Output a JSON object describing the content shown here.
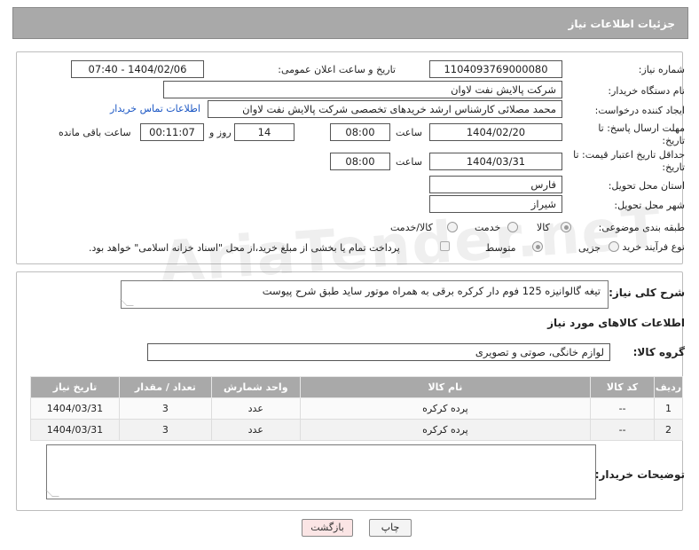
{
  "header": {
    "title": "جزئیات اطلاعات نیاز"
  },
  "fields": {
    "need_number_label": "شماره نیاز:",
    "need_number": "1104093769000080",
    "announce_label": "تاریخ و ساعت اعلان عمومی:",
    "announce_value": "1404/02/06 - 07:40",
    "buyer_org_label": "نام دستگاه خریدار:",
    "buyer_org": "شرکت پالایش نفت لاوان",
    "creator_label": "ایجاد کننده درخواست:",
    "creator": "محمد مصلائی کارشناس ارشد خریدهای تخصصی شرکت پالایش نفت لاوان",
    "contact_link": "اطلاعات تماس خریدار",
    "reply_deadline_label": "مهلت ارسال پاسخ: تا تاریخ:",
    "reply_date": "1404/02/20",
    "time_label": "ساعت",
    "reply_time": "08:00",
    "days_value": "14",
    "days_label": "روز و",
    "remaining_time": "00:11:07",
    "remaining_label": "ساعت باقی مانده",
    "price_validity_label": "حداقل تاریخ اعتبار قیمت: تا تاریخ:",
    "price_date": "1404/03/31",
    "price_time": "08:00",
    "province_label": "استان محل تحویل:",
    "province": "فارس",
    "city_label": "شهر محل تحویل:",
    "city": "شیراز",
    "category_label": "طبقه بندی موضوعی:",
    "cat_goods": "کالا",
    "cat_service": "خدمت",
    "cat_both": "کالا/خدمت",
    "process_label": "نوع فرآیند خرید :",
    "proc_partial": "جزیی",
    "proc_medium": "متوسط",
    "payment_note": "پرداخت تمام یا بخشی از مبلغ خرید،از محل \"اسناد خزانه اسلامی\" خواهد بود."
  },
  "description": {
    "label": "شرح کلی نیاز:",
    "text": "تیغه گالوانیزه 125 فوم دار کرکره برقی به همراه موتور ساید طبق شرح پیوست"
  },
  "goods": {
    "section_title": "اطلاعات کالاهای مورد نیاز",
    "group_label": "گروه کالا:",
    "group_value": "لوازم خانگی، صوتی و تصویری",
    "columns": [
      "ردیف",
      "کد کالا",
      "نام کالا",
      "واحد شمارش",
      "تعداد / مقدار",
      "تاریخ نیاز"
    ],
    "rows": [
      [
        "1",
        "--",
        "پرده کرکره",
        "عدد",
        "3",
        "1404/03/31"
      ],
      [
        "2",
        "--",
        "پرده کرکره",
        "عدد",
        "3",
        "1404/03/31"
      ]
    ]
  },
  "buyer_notes": {
    "label": "توضیحات خریدار:",
    "text": ""
  },
  "buttons": {
    "print": "چاپ",
    "back": "بازگشت"
  },
  "watermark": "AriaTender.neT"
}
